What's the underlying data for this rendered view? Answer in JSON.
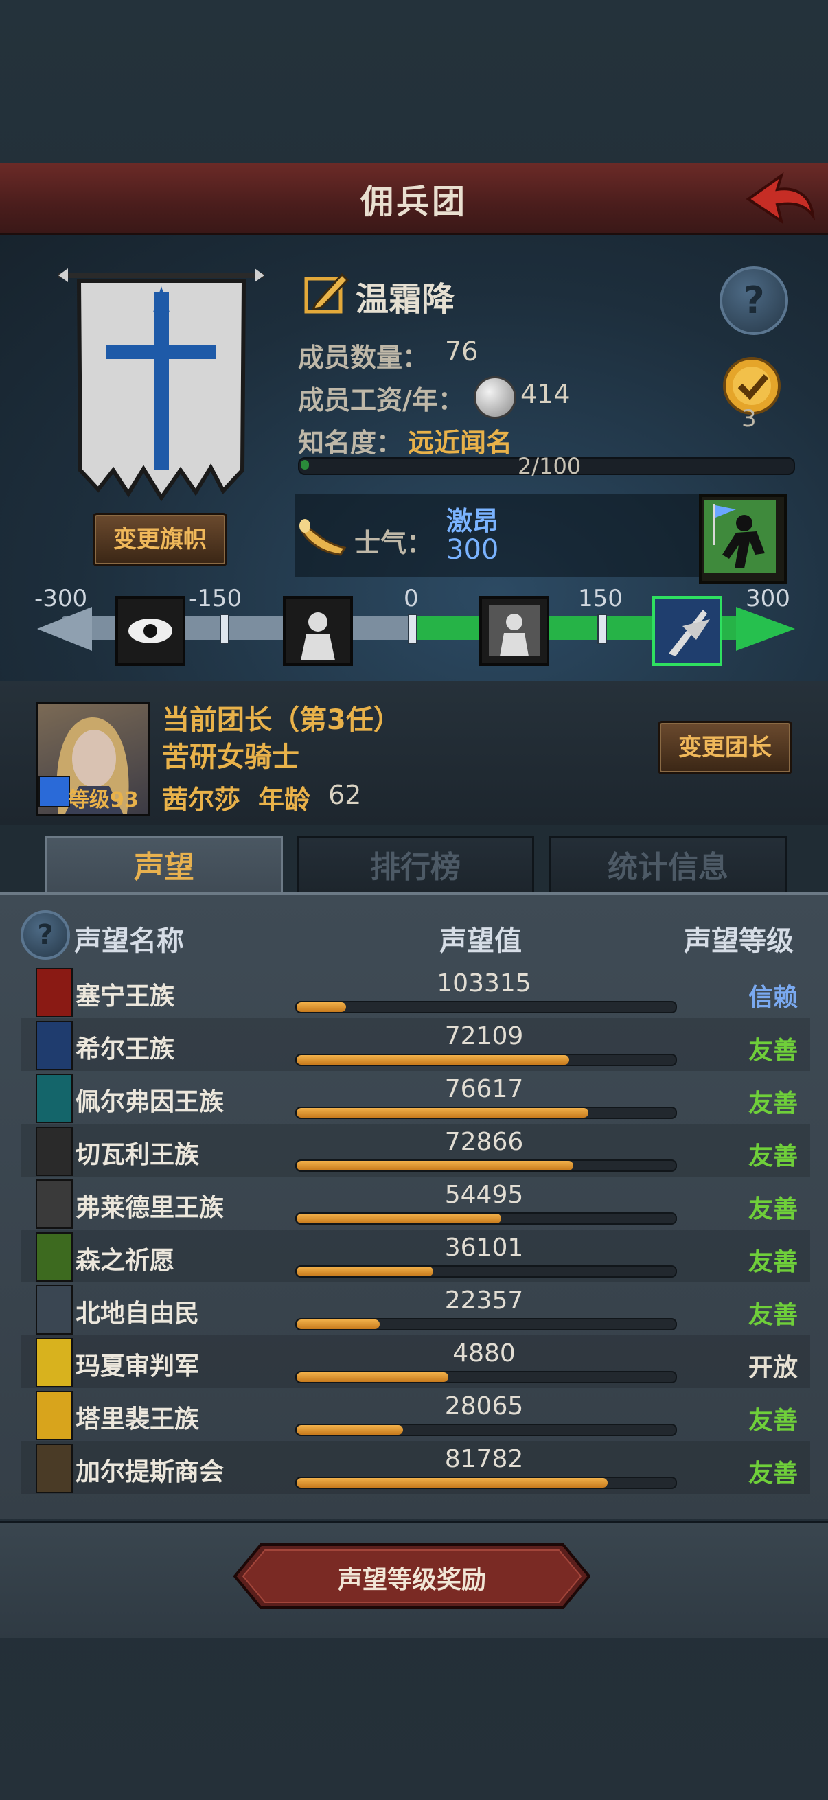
{
  "header": {
    "title": "佣兵团",
    "back_icon": "red-back-arrow-icon"
  },
  "company": {
    "name": "温霜降",
    "members_label": "成员数量：",
    "members_value": "76",
    "wage_label": "成员工资/年：",
    "wage_value": "414",
    "fame_label": "知名度：",
    "fame_value": "远近闻名",
    "fame_progress_text": "2/100",
    "fame_progress": 0.02,
    "badge_count": "3",
    "change_banner_label": "变更旗帜",
    "morale_label": "士气：",
    "morale_state": "激昂",
    "morale_value": "300"
  },
  "morale_scale": {
    "ticks": [
      "-300",
      "-150",
      "0",
      "150",
      "300"
    ],
    "current": 300,
    "range": [
      -300,
      300
    ]
  },
  "leader": {
    "title": "当前团长（第3任）",
    "class_name": "苦研女骑士",
    "name": "茜尔莎",
    "age_label": "年龄",
    "age_value": "62",
    "level_text": "等级93",
    "change_leader_label": "变更团长"
  },
  "tabs": [
    {
      "label": "声望",
      "active": true
    },
    {
      "label": "排行榜",
      "active": false
    },
    {
      "label": "统计信息",
      "active": false
    }
  ],
  "table": {
    "col_name": "声望名称",
    "col_value": "声望值",
    "col_level": "声望等级"
  },
  "factions": [
    {
      "name": "塞宁王族",
      "value": "103315",
      "fill": 0.13,
      "level": "信赖",
      "level_color": "#7aa9f0",
      "icon_color": "#8a1a14"
    },
    {
      "name": "希尔王族",
      "value": "72109",
      "fill": 0.72,
      "level": "友善",
      "level_color": "#6fcf3a",
      "icon_color": "#1f3c6e"
    },
    {
      "name": "佩尔弗因王族",
      "value": "76617",
      "fill": 0.77,
      "level": "友善",
      "level_color": "#6fcf3a",
      "icon_color": "#14656a"
    },
    {
      "name": "切瓦利王族",
      "value": "72866",
      "fill": 0.73,
      "level": "友善",
      "level_color": "#6fcf3a",
      "icon_color": "#2a2a2a"
    },
    {
      "name": "弗莱德里王族",
      "value": "54495",
      "fill": 0.54,
      "level": "友善",
      "level_color": "#6fcf3a",
      "icon_color": "#3a3a3a"
    },
    {
      "name": "森之祈愿",
      "value": "36101",
      "fill": 0.36,
      "level": "友善",
      "level_color": "#6fcf3a",
      "icon_color": "#3d6a1f"
    },
    {
      "name": "北地自由民",
      "value": "22357",
      "fill": 0.22,
      "level": "友善",
      "level_color": "#6fcf3a",
      "icon_color": "#3a4652"
    },
    {
      "name": "玛夏审判军",
      "value": "4880",
      "fill": 0.4,
      "level": "开放",
      "level_color": "#e6e0d2",
      "icon_color": "#d8b21e"
    },
    {
      "name": "塔里裴王族",
      "value": "28065",
      "fill": 0.28,
      "level": "友善",
      "level_color": "#6fcf3a",
      "icon_color": "#d8a41c"
    },
    {
      "name": "加尔提斯商会",
      "value": "81782",
      "fill": 0.82,
      "level": "友善",
      "level_color": "#6fcf3a",
      "icon_color": "#4a3b26"
    }
  ],
  "footer": {
    "reward_label": "声望等级奖励"
  }
}
